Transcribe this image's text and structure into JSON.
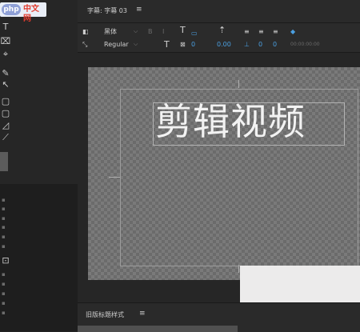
{
  "logo": {
    "badge": "php",
    "site": "中文网"
  },
  "title_tab": {
    "label": "字幕: 字幕 03",
    "menu": "≡"
  },
  "toolbar": {
    "font_name": "黑体",
    "font_style": "Regular",
    "size_glyph_a": "T",
    "size_glyph_b": "T",
    "dropdown_arrow": "⌵",
    "bold_label": "B",
    "italic_label": "I",
    "kerning_value": "0",
    "leading_value": "0.00",
    "tracking_value": "0",
    "baseline_value": "0",
    "time_value": "00:00:00:00"
  },
  "canvas": {
    "caption": "剪辑视频"
  },
  "bottom_panel": {
    "label": "旧版标题样式",
    "menu": "≡"
  },
  "colors": {
    "background": "#232323",
    "checker_light": "#7a7a7a",
    "checker_dark": "#6b6b6b",
    "accent": "#4b9fe0"
  }
}
